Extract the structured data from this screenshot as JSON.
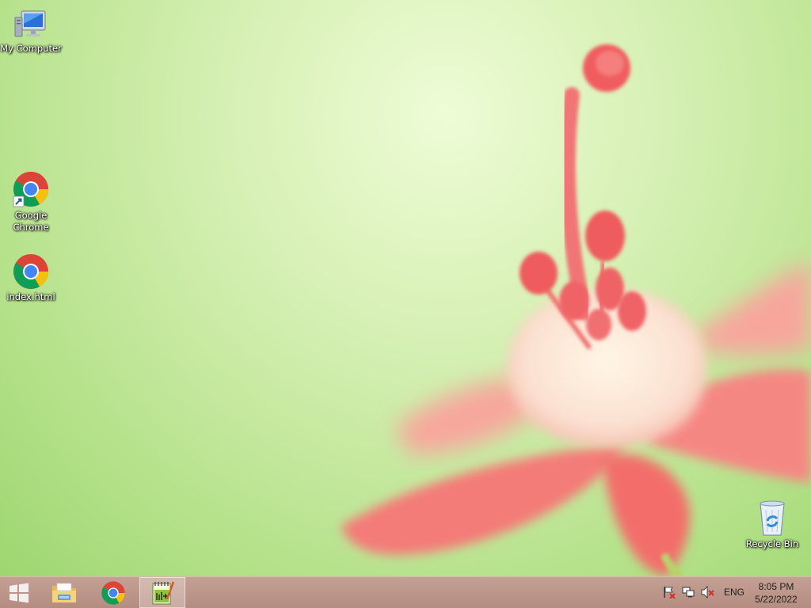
{
  "desktop": {
    "icons": [
      {
        "label": "My Computer",
        "icon": "computer-icon"
      },
      {
        "label": "Google Chrome",
        "icon": "chrome-icon",
        "shortcut": true
      },
      {
        "label": "index.html",
        "icon": "chrome-icon"
      },
      {
        "label": "Recycle Bin",
        "icon": "recycle-bin-icon"
      }
    ]
  },
  "taskbar": {
    "start_icon": "windows-start-icon",
    "pinned": [
      {
        "name": "File Explorer",
        "icon": "folder-icon"
      },
      {
        "name": "Google Chrome",
        "icon": "chrome-icon"
      },
      {
        "name": "Notepad++",
        "icon": "notepad-plus-plus-icon",
        "active": true
      }
    ],
    "tray": {
      "flag_icon": "action-center-flag-icon",
      "network_icon": "network-icon",
      "volume_icon": "volume-muted-icon",
      "language": "ENG"
    },
    "clock": {
      "time": "8:05 PM",
      "date": "5/22/2022"
    }
  },
  "colors": {
    "taskbar": "#b9938a",
    "wallpaper_light": "#eefcd6",
    "wallpaper_green": "#9ed670",
    "flower_pink": "#f06a6a"
  }
}
